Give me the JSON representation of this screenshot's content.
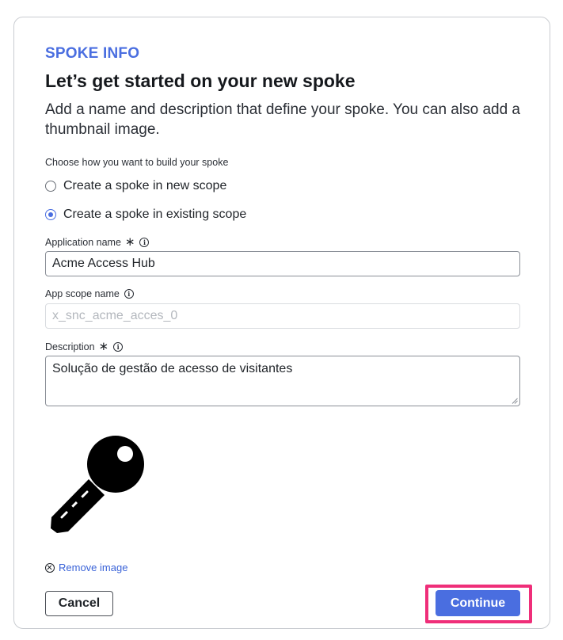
{
  "header": {
    "eyebrow": "SPOKE INFO",
    "title": "Let’s get started on your new spoke",
    "subtitle": "Add a name and description that define your spoke. You can also add a thumbnail image."
  },
  "build_options": {
    "label": "Choose how you want to build your spoke",
    "options": [
      {
        "label": "Create a spoke in new scope",
        "selected": false
      },
      {
        "label": "Create a spoke in existing scope",
        "selected": true
      }
    ]
  },
  "fields": {
    "application_name": {
      "label": "Application name",
      "required_marker": "∗",
      "value": "Acme Access Hub"
    },
    "app_scope_name": {
      "label": "App scope name",
      "placeholder": "x_snc_acme_acces_0"
    },
    "description": {
      "label": "Description",
      "required_marker": "∗",
      "value": "Solução de gestão de acesso de visitantes"
    }
  },
  "thumbnail": {
    "icon": "key-icon",
    "remove_label": "Remove image"
  },
  "actions": {
    "cancel_label": "Cancel",
    "continue_label": "Continue"
  },
  "colors": {
    "accent": "#4a6ee0",
    "highlight": "#ef2e79"
  }
}
